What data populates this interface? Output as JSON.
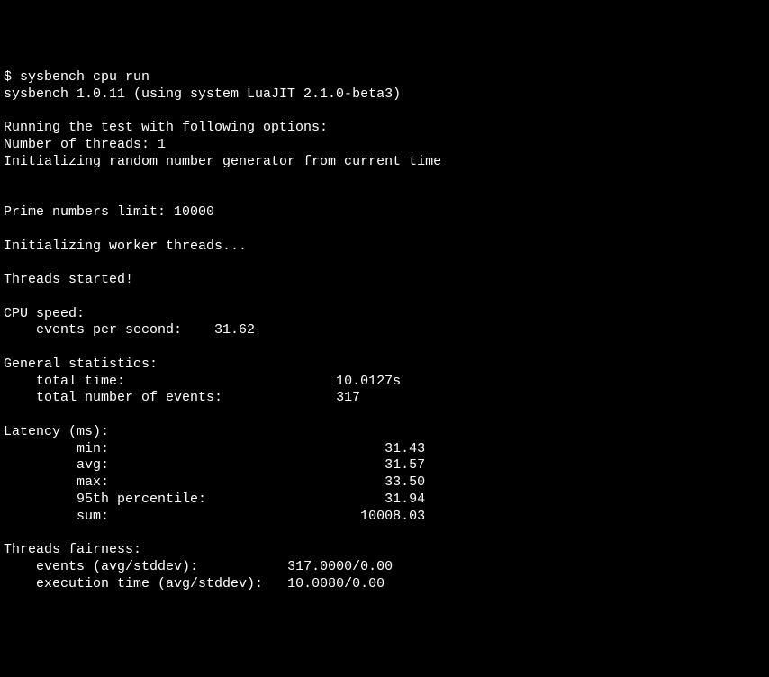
{
  "prompt": "$ ",
  "command": "sysbench cpu run",
  "version_line": "sysbench 1.0.11 (using system LuaJIT 2.1.0-beta3)",
  "running_options": "Running the test with following options:",
  "threads_line": "Number of threads: 1",
  "rng_line": "Initializing random number generator from current time",
  "prime_limit": "Prime numbers limit: 10000",
  "init_workers": "Initializing worker threads...",
  "threads_started": "Threads started!",
  "cpu_speed_header": "CPU speed:",
  "events_per_second_label": "    events per second:    ",
  "events_per_second_value": "31.62",
  "general_stats_header": "General statistics:",
  "total_time_label": "    total time:                          ",
  "total_time_value": "10.0127s",
  "total_events_label": "    total number of events:              ",
  "total_events_value": "317",
  "latency_header": "Latency (ms):",
  "latency_min_label": "         min:                                  ",
  "latency_min_value": "31.43",
  "latency_avg_label": "         avg:                                  ",
  "latency_avg_value": "31.57",
  "latency_max_label": "         max:                                  ",
  "latency_max_value": "33.50",
  "latency_95th_label": "         95th percentile:                      ",
  "latency_95th_value": "31.94",
  "latency_sum_label": "         sum:                               ",
  "latency_sum_value": "10008.03",
  "fairness_header": "Threads fairness:",
  "fairness_events_label": "    events (avg/stddev):           ",
  "fairness_events_value": "317.0000/0.00",
  "fairness_exec_label": "    execution time (avg/stddev):   ",
  "fairness_exec_value": "10.0080/0.00"
}
